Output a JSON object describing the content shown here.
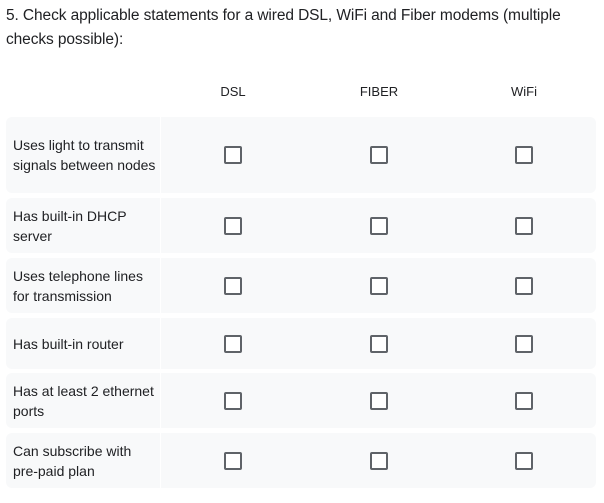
{
  "question": {
    "text": "5. Check applicable statements for a wired DSL, WiFi and Fiber modems (multiple checks possible):"
  },
  "columns": [
    "DSL",
    "FIBER",
    "WiFi"
  ],
  "rows": [
    {
      "label": "Uses light to transmit signals between nodes",
      "checked": [
        false,
        false,
        false
      ]
    },
    {
      "label": "Has built-in DHCP server",
      "checked": [
        false,
        false,
        false
      ]
    },
    {
      "label": "Uses telephone lines for transmission",
      "checked": [
        false,
        false,
        false
      ]
    },
    {
      "label": "Has built-in router",
      "checked": [
        false,
        false,
        false
      ]
    },
    {
      "label": "Has at least 2 ethernet ports",
      "checked": [
        false,
        false,
        false
      ]
    },
    {
      "label": "Can subscribe with pre-paid plan",
      "checked": [
        false,
        false,
        false
      ]
    }
  ],
  "colors": {
    "row_background": "#f8f9fa",
    "checkbox_border": "#5f6368",
    "text": "#202124"
  }
}
